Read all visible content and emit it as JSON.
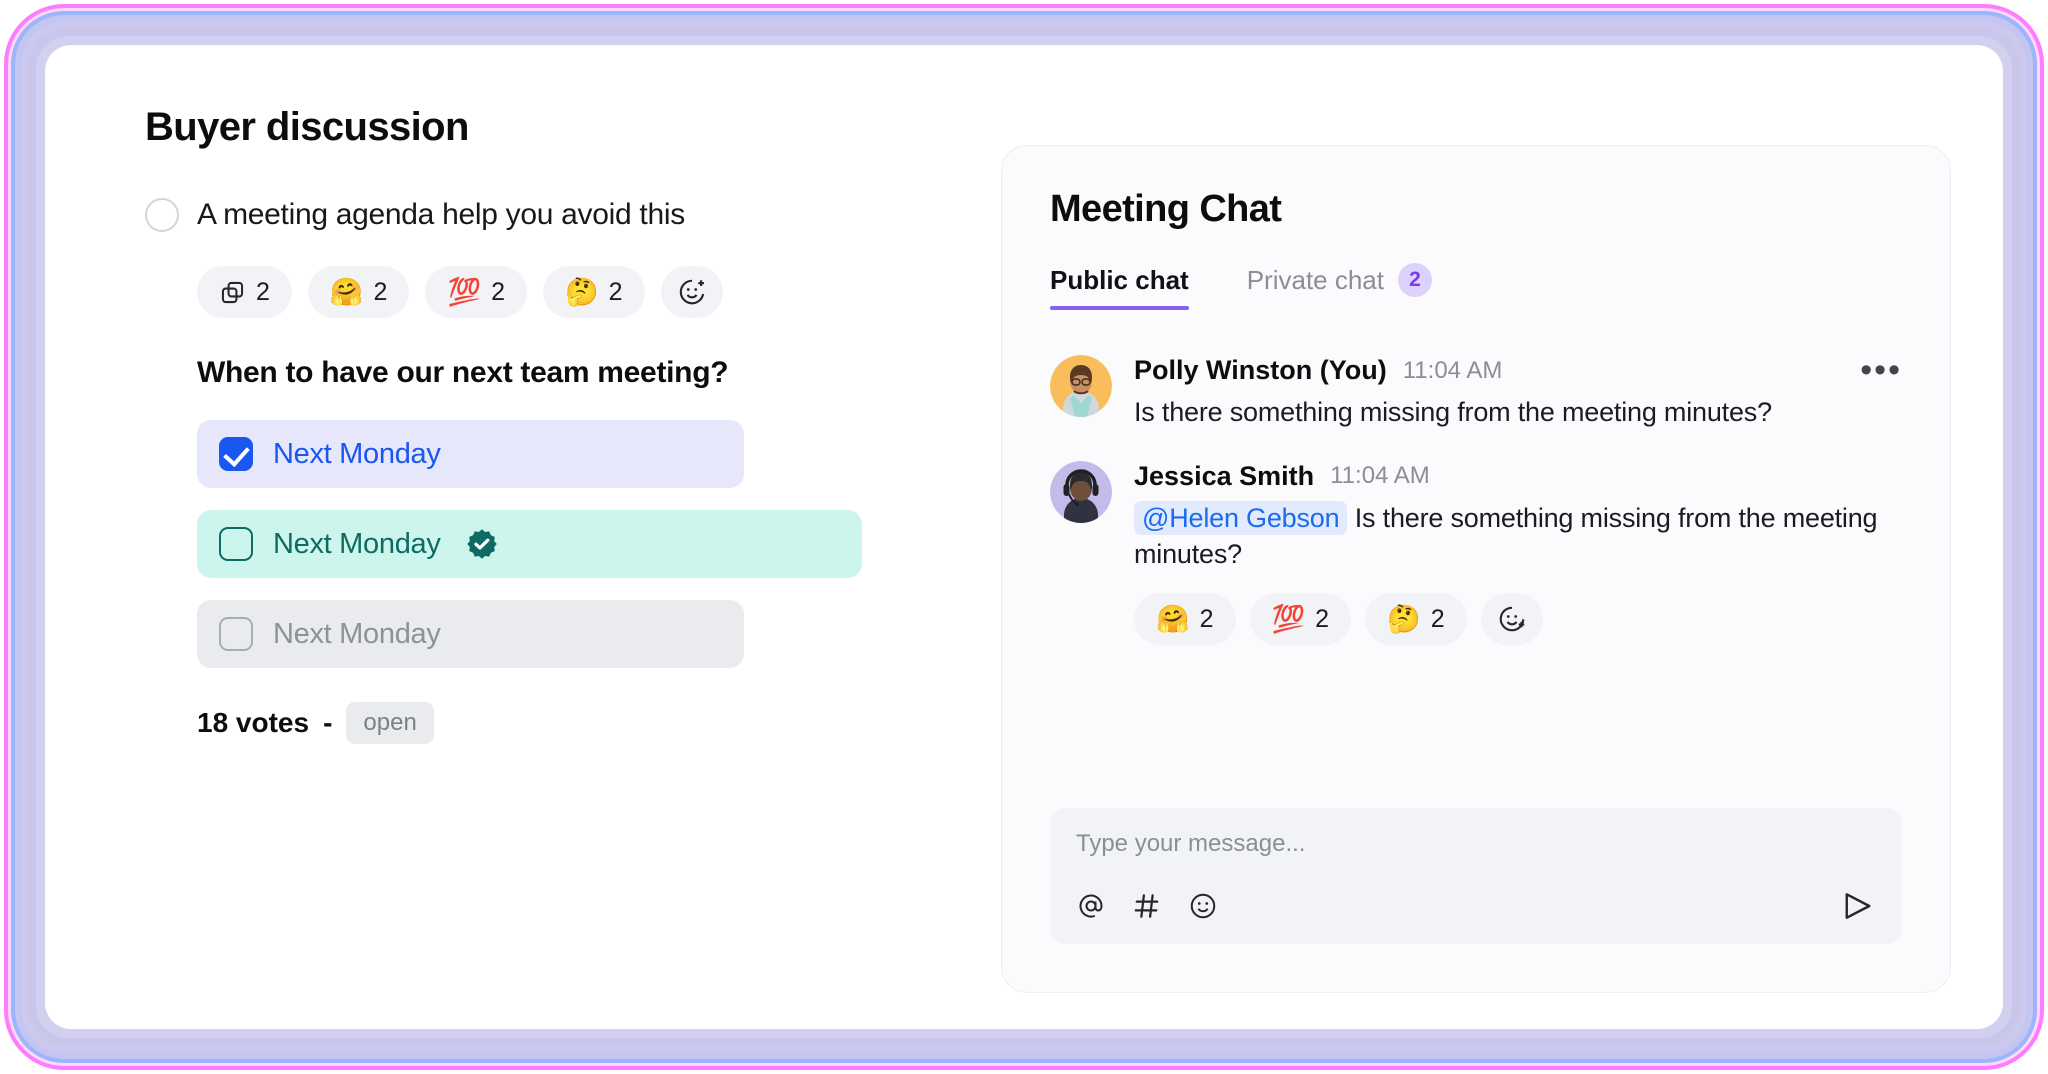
{
  "left": {
    "title": "Buyer discussion",
    "agenda": {
      "text": "A meeting agenda help you avoid this",
      "radio": "radio-empty"
    },
    "reactions": [
      {
        "icon": "copy-icon",
        "emoji": "",
        "count": "2"
      },
      {
        "icon": "emoji",
        "emoji": "🤗",
        "count": "2"
      },
      {
        "icon": "emoji",
        "emoji": "💯",
        "count": "2"
      },
      {
        "icon": "emoji",
        "emoji": "🤔",
        "count": "2"
      },
      {
        "icon": "add-reaction-icon",
        "emoji": "",
        "count": ""
      }
    ],
    "poll": {
      "question": "When to have our next team meeting?",
      "options": [
        {
          "label": "Next Monday",
          "state": "selected",
          "checked": true,
          "verified": false
        },
        {
          "label": "Next Monday",
          "state": "verified",
          "checked": false,
          "verified": true
        },
        {
          "label": "Next Monday",
          "state": "muted",
          "checked": false,
          "verified": false
        }
      ],
      "votes_text": "18 votes",
      "separator": "-",
      "status": "open"
    }
  },
  "chat": {
    "title": "Meeting Chat",
    "tabs": [
      {
        "label": "Public chat",
        "active": true,
        "badge": ""
      },
      {
        "label": "Private chat",
        "active": false,
        "badge": "2"
      }
    ],
    "messages": [
      {
        "name": "Polly Winston (You)",
        "time": "11:04 AM",
        "text": "Is there something missing from the meeting minutes?",
        "mention": "",
        "menu": "•••",
        "avatar_bg": "#f9bd5c"
      },
      {
        "name": "Jessica Smith",
        "time": "11:04 AM",
        "mention": "@Helen Gebson",
        "text": "Is there something missing from the meeting minutes?",
        "menu": "",
        "avatar_bg": "#c3bcea",
        "reactions": [
          {
            "emoji": "🤗",
            "count": "2"
          },
          {
            "emoji": "💯",
            "count": "2"
          },
          {
            "emoji": "🤔",
            "count": "2"
          },
          {
            "emoji": "",
            "count": "",
            "icon": "add-reaction-icon"
          }
        ]
      }
    ],
    "composer": {
      "placeholder": "Type your message...",
      "mention_icon": "at-icon",
      "hash_icon": "hash-icon",
      "emoji_icon": "emoji-icon",
      "send_icon": "send-icon"
    }
  },
  "colors": {
    "accent_purple": "#8b5cf6",
    "blue": "#1a56f0",
    "teal": "#0f6b62",
    "teal_bg": "#ccf5ee",
    "blue_bg": "#e6e7fb",
    "grey_bg": "#e9ebee"
  }
}
